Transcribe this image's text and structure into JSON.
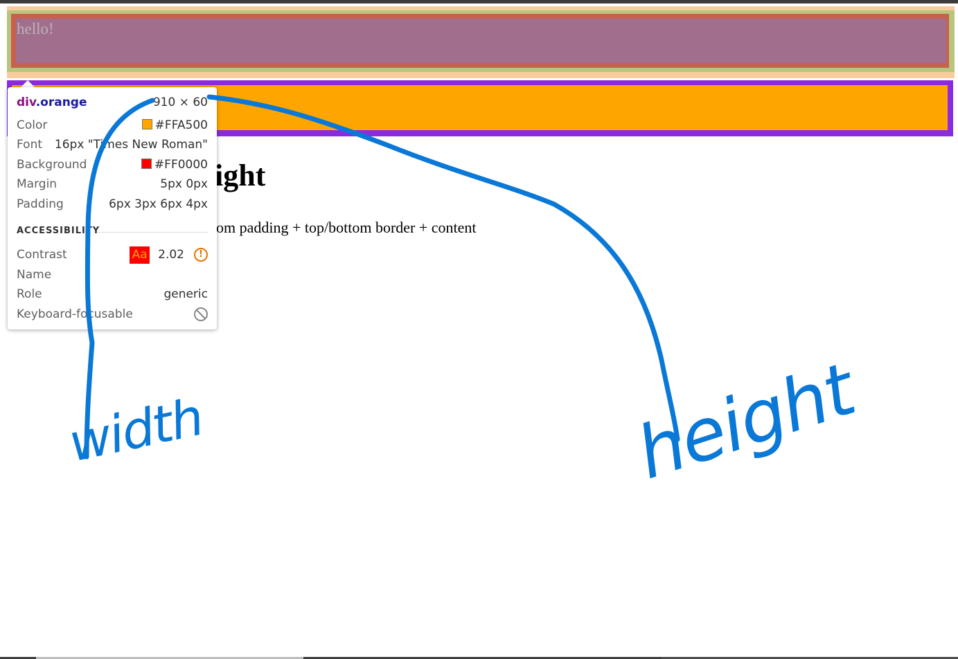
{
  "page": {
    "hello_text": "hello!",
    "heading": "ight",
    "body_text": "om padding + top/bottom border + content"
  },
  "tooltip": {
    "selector_tag": "div",
    "selector_class": ".orange",
    "size": "910 × 60",
    "rows": {
      "color_label": "Color",
      "color_value": "#FFA500",
      "font_label": "Font",
      "font_value": "16px \"Times New Roman\"",
      "background_label": "Background",
      "background_value": "#FF0000",
      "margin_label": "Margin",
      "margin_value": "5px 0px",
      "padding_label": "Padding",
      "padding_value": "6px 3px 6px 4px"
    },
    "accessibility": {
      "section_label": "ACCESSIBILITY",
      "contrast_label": "Contrast",
      "contrast_sample": "Aa",
      "contrast_value": "2.02",
      "name_label": "Name",
      "role_label": "Role",
      "role_value": "generic",
      "keyboard_label": "Keyboard-focusable"
    }
  },
  "annotations": {
    "width_label": "width",
    "height_label": "height",
    "ink_color": "#0a78d7"
  },
  "colors": {
    "orange": "#FFA500",
    "red": "#FF0000",
    "purple_border": "#8A2BE2"
  }
}
